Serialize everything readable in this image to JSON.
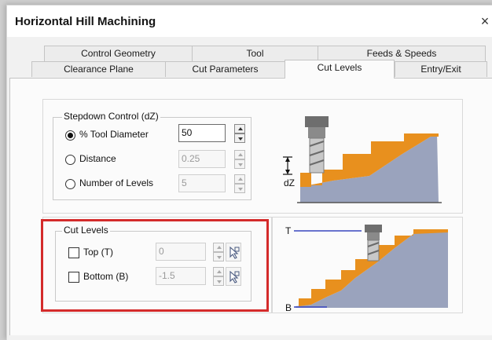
{
  "window": {
    "title": "Horizontal Hill Machining",
    "close_label": "×"
  },
  "tabs": {
    "back_row": [
      "Control Geometry",
      "Tool",
      "Feeds & Speeds"
    ],
    "front_row": [
      "Clearance Plane",
      "Cut Parameters",
      "Cut Levels",
      "Entry/Exit"
    ],
    "active": "Cut Levels"
  },
  "stepdown": {
    "group_title": "Stepdown Control (dZ)",
    "options": [
      {
        "label": "% Tool Diameter",
        "value": "50",
        "selected": true
      },
      {
        "label": "Distance",
        "value": "0.25",
        "selected": false
      },
      {
        "label": "Number of Levels",
        "value": "5",
        "selected": false
      }
    ],
    "diagram_label": "dZ"
  },
  "cut_levels": {
    "group_title": "Cut Levels",
    "top": {
      "label": "Top (T)",
      "value": "0",
      "checked": false
    },
    "bottom": {
      "label": "Bottom (B)",
      "value": "-1.5",
      "checked": false
    },
    "diagram_top_label": "T",
    "diagram_bottom_label": "B"
  },
  "colors": {
    "highlight_border": "#d42b2b",
    "step_orange": "#e8901e",
    "part_gray": "#9aa3bd",
    "limit_line": "#3946c0"
  }
}
